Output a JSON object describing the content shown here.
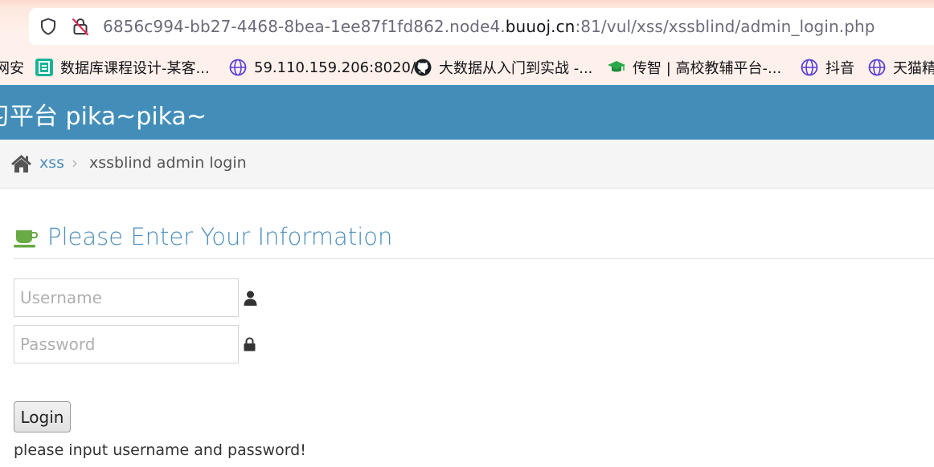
{
  "browser": {
    "url_prefix": "6856c994-bb27-4468-8bea-1ee87f1fd862.node4.",
    "url_host": "buuoj.cn",
    "url_suffix": ":81/vul/xss/xssblind/admin_login.php",
    "shield_icon": "shield-icon",
    "insecure_icon": "lock-crossed-icon"
  },
  "bookmarks": [
    {
      "label": "网安",
      "icon": ""
    },
    {
      "label": "数据库课程设计-某客...",
      "icon": "teal-book-icon"
    },
    {
      "label": "59.110.159.206:8020/",
      "icon": "globe-icon"
    },
    {
      "label": "大数据从入门到实战 -...",
      "icon": "github-icon"
    },
    {
      "label": "传智 | 高校教辅平台-...",
      "icon": "graduation-cap-icon"
    },
    {
      "label": "抖音",
      "icon": "globe-icon"
    },
    {
      "label": "天猫精",
      "icon": "globe-icon"
    }
  ],
  "site": {
    "title": "习平台 pika~pika~",
    "header_color": "#438eb9"
  },
  "breadcrumb": {
    "home_icon": "home-icon",
    "parent": "xss",
    "separator": "›",
    "current": "xssblind admin login"
  },
  "page": {
    "heading_icon": "coffee-cup-icon",
    "heading": "Please Enter Your Information",
    "accent_color": "#4c8fbd"
  },
  "form": {
    "username": {
      "placeholder": "Username",
      "value": "",
      "icon": "user-icon"
    },
    "password": {
      "placeholder": "Password",
      "value": "",
      "icon": "lock-icon"
    },
    "login_label": "Login",
    "status_message": "please input username and password!"
  }
}
